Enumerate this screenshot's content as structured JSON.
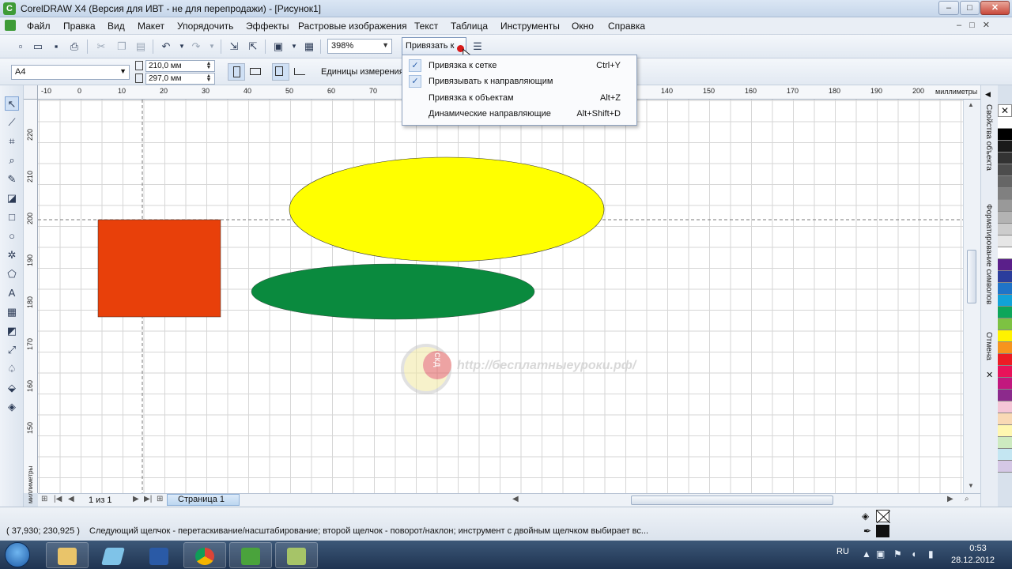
{
  "window": {
    "title": "CorelDRAW X4 (Версия для ИВТ - не для перепродажи) - [Рисунок1]"
  },
  "menubar": {
    "items": [
      "Файл",
      "Правка",
      "Вид",
      "Макет",
      "Упорядочить",
      "Эффекты",
      "Растровые изображения",
      "Текст",
      "Таблица",
      "Инструменты",
      "Окно",
      "Справка"
    ]
  },
  "toolbar": {
    "zoom": "398%",
    "snap_button": "Привязать к"
  },
  "snap_menu": {
    "items": [
      {
        "label": "Привязка к сетке",
        "shortcut": "Ctrl+Y",
        "checked": true
      },
      {
        "label": "Привязывать к направляющим",
        "shortcut": "",
        "checked": true
      },
      {
        "label": "Привязка к объектам",
        "shortcut": "Alt+Z",
        "checked": false
      },
      {
        "label": "Динамические направляющие",
        "shortcut": "Alt+Shift+D",
        "checked": false
      }
    ]
  },
  "property_bar": {
    "page_size": "A4",
    "width": "210,0 мм",
    "height": "297,0 мм",
    "units_label": "Единицы измерения:"
  },
  "rulers": {
    "units": "миллиметры",
    "top_ticks": [
      "0",
      "10",
      "20",
      "30",
      "40",
      "50",
      "60",
      "70",
      "140",
      "150",
      "160",
      "170",
      "180",
      "190",
      "200"
    ],
    "left_ticks": [
      "220",
      "210",
      "200",
      "190",
      "180",
      "170",
      "160",
      "150"
    ]
  },
  "canvas_objects": {
    "rectangle_color": "#e8400a",
    "yellow_ellipse_color": "#ffff00",
    "green_ellipse_color": "#0a8a3e",
    "watermark_text": "http://бесплатныеуроки.рф/",
    "watermark_logo_text": "СКД"
  },
  "page_nav": {
    "count": "1 из 1",
    "tab_label": "Страница 1"
  },
  "docker": {
    "tabs": [
      "Свойства объекта",
      "Форматирование символов",
      "Отмена"
    ]
  },
  "palette_colors": [
    "#ffffff",
    "#000000",
    "#1a1a1a",
    "#333333",
    "#4d4d4d",
    "#666666",
    "#808080",
    "#999999",
    "#b3b3b3",
    "#cccccc",
    "#e6e6e6",
    "#ffffff",
    "#5a1f8a",
    "#2b3d9c",
    "#1f74c8",
    "#11a2d8",
    "#0ea65a",
    "#7dc242",
    "#fff200",
    "#f7941d",
    "#ed1c24",
    "#e8135a",
    "#c2187e",
    "#8c2a8c",
    "#f5c6d6",
    "#f9d9b5",
    "#fff7b0",
    "#cdeac0",
    "#c4e6f2",
    "#d5c8e6"
  ],
  "status": {
    "coords": "( 37,930; 230,925 )",
    "hint": "Следующий щелчок - перетаскивание/насштабирование; второй щелчок - поворот/наклон; инструмент с двойным щелчком выбирает вс..."
  },
  "taskbar": {
    "lang": "RU",
    "time": "0:53",
    "date": "28.12.2012"
  }
}
